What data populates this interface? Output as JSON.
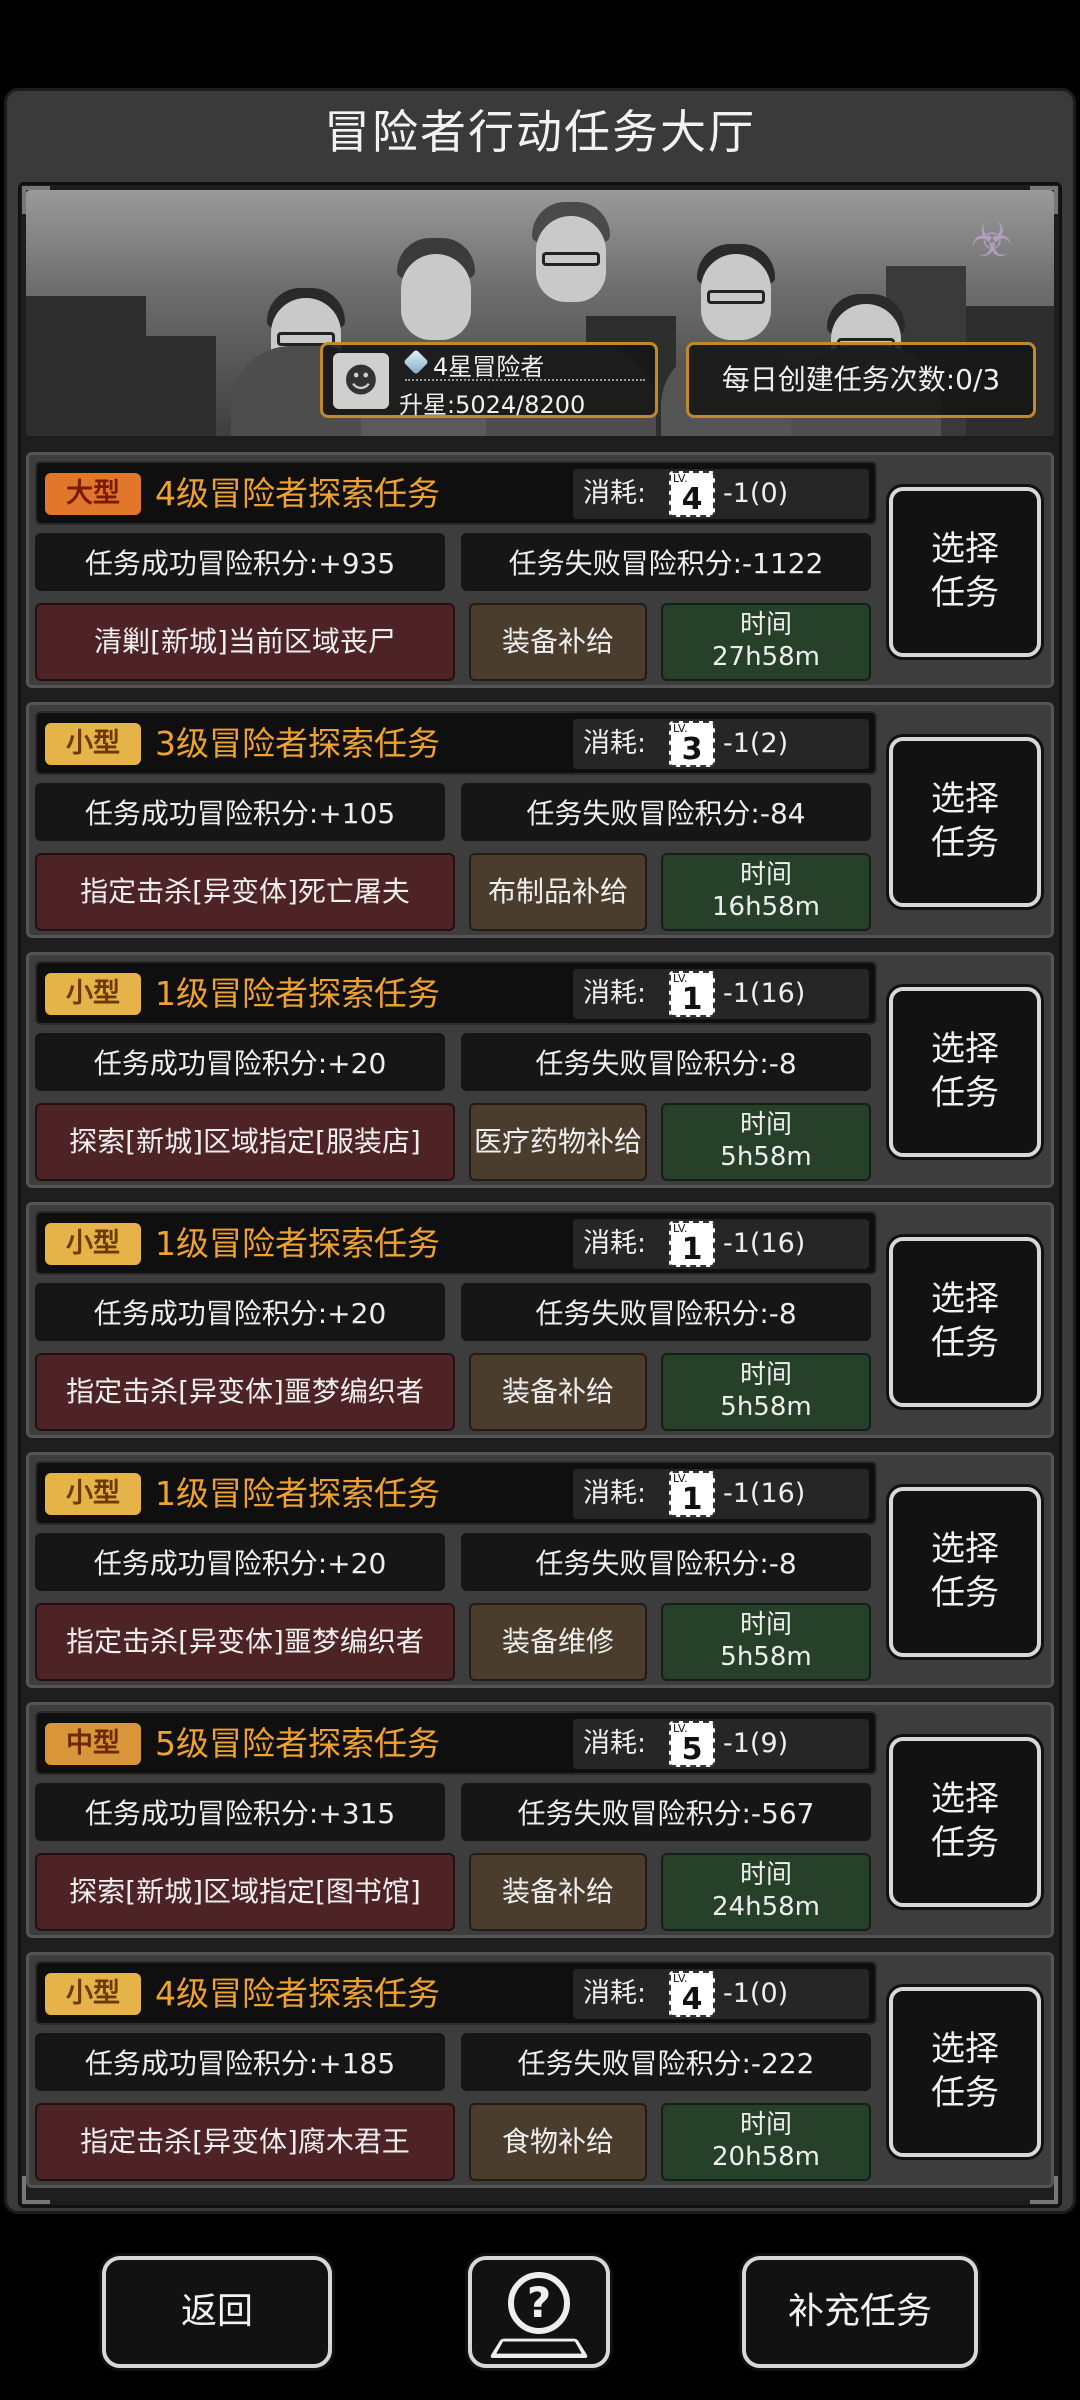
{
  "title": "冒险者行动任务大厅",
  "rank": {
    "title": "4星冒险者",
    "progress": "升星:5024/8200"
  },
  "daily": "每日创建任务次数:0/3",
  "cost_label": "消耗:",
  "select_label_line1": "选择",
  "select_label_line2": "任务",
  "time_label": "时间",
  "tasks": [
    {
      "size": "大型",
      "name": "4级冒险者探索任务",
      "lv": "4",
      "cost": "-1(0)",
      "success": "任务成功冒险积分:+935",
      "fail": "任务失败冒险积分:-1122",
      "objective": "清剿[新城]当前区域丧尸",
      "reward": "装备补给",
      "time": "27h58m"
    },
    {
      "size": "小型",
      "name": "3级冒险者探索任务",
      "lv": "3",
      "cost": "-1(2)",
      "success": "任务成功冒险积分:+105",
      "fail": "任务失败冒险积分:-84",
      "objective": "指定击杀[异变体]死亡屠夫",
      "reward": "布制品补给",
      "time": "16h58m"
    },
    {
      "size": "小型",
      "name": "1级冒险者探索任务",
      "lv": "1",
      "cost": "-1(16)",
      "success": "任务成功冒险积分:+20",
      "fail": "任务失败冒险积分:-8",
      "objective": "探索[新城]区域指定[服装店]",
      "reward": "医疗药物补给",
      "time": "5h58m"
    },
    {
      "size": "小型",
      "name": "1级冒险者探索任务",
      "lv": "1",
      "cost": "-1(16)",
      "success": "任务成功冒险积分:+20",
      "fail": "任务失败冒险积分:-8",
      "objective": "指定击杀[异变体]噩梦编织者",
      "reward": "装备补给",
      "time": "5h58m"
    },
    {
      "size": "小型",
      "name": "1级冒险者探索任务",
      "lv": "1",
      "cost": "-1(16)",
      "success": "任务成功冒险积分:+20",
      "fail": "任务失败冒险积分:-8",
      "objective": "指定击杀[异变体]噩梦编织者",
      "reward": "装备维修",
      "time": "5h58m"
    },
    {
      "size": "中型",
      "name": "5级冒险者探索任务",
      "lv": "5",
      "cost": "-1(9)",
      "success": "任务成功冒险积分:+315",
      "fail": "任务失败冒险积分:-567",
      "objective": "探索[新城]区域指定[图书馆]",
      "reward": "装备补给",
      "time": "24h58m"
    },
    {
      "size": "小型",
      "name": "4级冒险者探索任务",
      "lv": "4",
      "cost": "-1(0)",
      "success": "任务成功冒险积分:+185",
      "fail": "任务失败冒险积分:-222",
      "objective": "指定击杀[异变体]腐木君王",
      "reward": "食物补给",
      "time": "20h58m"
    }
  ],
  "bottom": {
    "back": "返回",
    "help_icon": "help-map-icon",
    "refill": "补充任务"
  },
  "colors": {
    "accent": "#f0a22e",
    "large_badge": "#e0772a",
    "small_badge": "#e6b348",
    "objective_bg": "#4d2325",
    "reward_bg": "#4a3d2d",
    "time_bg": "#26402a"
  }
}
